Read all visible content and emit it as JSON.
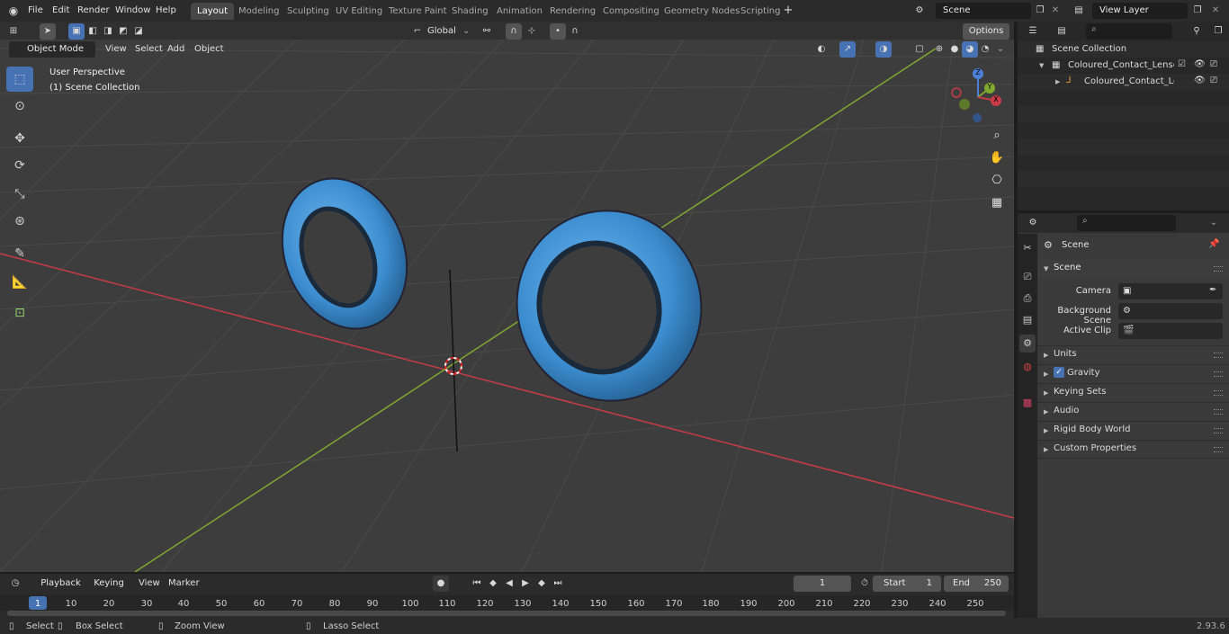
{
  "app": {
    "version": "2.93.6"
  },
  "menubar": {
    "items": [
      "File",
      "Edit",
      "Render",
      "Window",
      "Help"
    ]
  },
  "workspaces": {
    "tabs": [
      "Layout",
      "Modeling",
      "Sculpting",
      "UV Editing",
      "Texture Paint",
      "Shading",
      "Animation",
      "Rendering",
      "Compositing",
      "Geometry Nodes",
      "Scripting"
    ],
    "active": "Layout"
  },
  "scene": {
    "name": "Scene"
  },
  "view_layer": {
    "name": "View Layer"
  },
  "viewport_header": {
    "mode": "Object Mode",
    "menus": [
      "View",
      "Select",
      "Add",
      "Object"
    ],
    "orientation": "Global",
    "options_label": "Options"
  },
  "viewport": {
    "perspective": "User Perspective",
    "collection": "(1) Scene Collection"
  },
  "gizmo": {
    "x": "X",
    "y": "Y",
    "z": "Z"
  },
  "outliner": {
    "root": "Scene Collection",
    "items": [
      "Coloured_Contact_Lenses_Bl",
      "Coloured_Contact_Lense"
    ]
  },
  "properties": {
    "context": "Scene",
    "section": "Scene",
    "fields": [
      {
        "label": "Camera",
        "value": ""
      },
      {
        "label": "Background Scene",
        "value": ""
      },
      {
        "label": "Active Clip",
        "value": ""
      }
    ],
    "panels": [
      "Units",
      "Gravity",
      "Keying Sets",
      "Audio",
      "Rigid Body World",
      "Custom Properties"
    ],
    "gravity_checked": true
  },
  "timeline": {
    "menus": [
      "Playback",
      "Keying",
      "View",
      "Marker"
    ],
    "current_frame": "1",
    "start_label": "Start",
    "start": "1",
    "end_label": "End",
    "end": "250",
    "ticks": [
      "1",
      "10",
      "20",
      "30",
      "40",
      "50",
      "60",
      "70",
      "80",
      "90",
      "100",
      "110",
      "120",
      "130",
      "140",
      "150",
      "160",
      "170",
      "180",
      "190",
      "200",
      "210",
      "220",
      "230",
      "240",
      "250"
    ]
  },
  "statusbar": {
    "items": [
      "Select",
      "Box Select",
      "Zoom View",
      "Lasso Select"
    ]
  },
  "colors": {
    "accent": "#4772b3",
    "x_axis": "#c83c46",
    "y_axis": "#7fa831",
    "lens": "#3c8dd0"
  }
}
